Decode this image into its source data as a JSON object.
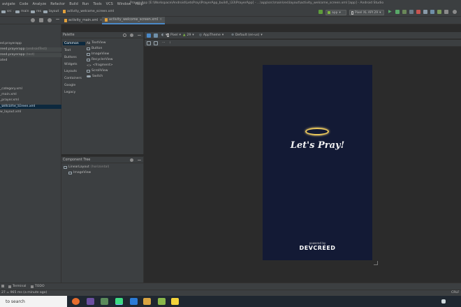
{
  "menu": [
    "avigate",
    "Code",
    "Analyze",
    "Refactor",
    "Build",
    "Run",
    "Tools",
    "VCS",
    "Window",
    "Help"
  ],
  "window_title": "Prayer App [E:\\Workspace\\Android\\LetsPray\\PrayerApp_build\\_\\33\\PrayerApp] - ...\\app\\src\\main\\res\\layout\\activity_welcome_screen.xml [app] - Android Studio",
  "breadcrumbs": [
    "src",
    "main",
    "res",
    "layout",
    "activity_welcome_screen.xml"
  ],
  "run_config": "app",
  "device": "Pixel XL API 29",
  "editor_tabs": [
    {
      "label": "activity_main.xml",
      "active": false
    },
    {
      "label": "activity_welcome_screen.xml",
      "active": true
    }
  ],
  "project": {
    "rows": [
      {
        "text": "ed.prayerapp",
        "extra": "",
        "style": "normal"
      },
      {
        "text": "reed.prayerapp",
        "extra": "(androidTest)",
        "style": "hl"
      },
      {
        "text": "reed.prayerapp",
        "extra": "(test)",
        "style": "hl"
      },
      {
        "text": "ated",
        "extra": "",
        "style": "normal"
      },
      {
        "text": "_category.xml",
        "extra": "",
        "style": "normal"
      },
      {
        "text": "_main.xml",
        "extra": "",
        "style": "normal"
      },
      {
        "text": "_prayer.xml",
        "extra": "",
        "style": "normal"
      },
      {
        "text": "_prayers.xml",
        "extra": "",
        "style": "normal"
      },
      {
        "text": "_welcome_screen.xml",
        "extra": "",
        "style": "sel"
      },
      {
        "text": "w_layout.xml",
        "extra": "",
        "style": "normal"
      }
    ]
  },
  "palette": {
    "title": "Palette",
    "categories": [
      "Common",
      "Text",
      "Buttons",
      "Widgets",
      "Layouts",
      "Containers",
      "Google",
      "Legacy"
    ],
    "selected_category": "Common",
    "widgets": [
      "TextView",
      "Button",
      "ImageView",
      "RecyclerView",
      "<fragment>",
      "ScrollView",
      "Switch"
    ]
  },
  "component_tree": {
    "title": "Component Tree",
    "nodes": [
      {
        "label": "LinearLayout",
        "extra": "(horizontal)"
      },
      {
        "label": "ImageView",
        "extra": ""
      }
    ]
  },
  "design_toolbar": {
    "device": "Pixel",
    "api": "29",
    "theme": "AppTheme",
    "locale": "Default (en-us)"
  },
  "preview": {
    "headline": "Let's Pray!",
    "powered_by": "powered by",
    "brand": "DEVCREED"
  },
  "bottom_tools": [
    "",
    "Terminal",
    "TODO"
  ],
  "status_text": "27 = 965 ms (a minute ago)",
  "status_right": "CRLF",
  "taskbar": {
    "search": "to search"
  },
  "colors": {
    "ide_bg": "#2b2b2b",
    "panel_bg": "#3c3f41",
    "selection": "#0d293e",
    "preview_bg": "#131a35",
    "halo": "#e8c65a",
    "accent": "#4a88c7"
  }
}
